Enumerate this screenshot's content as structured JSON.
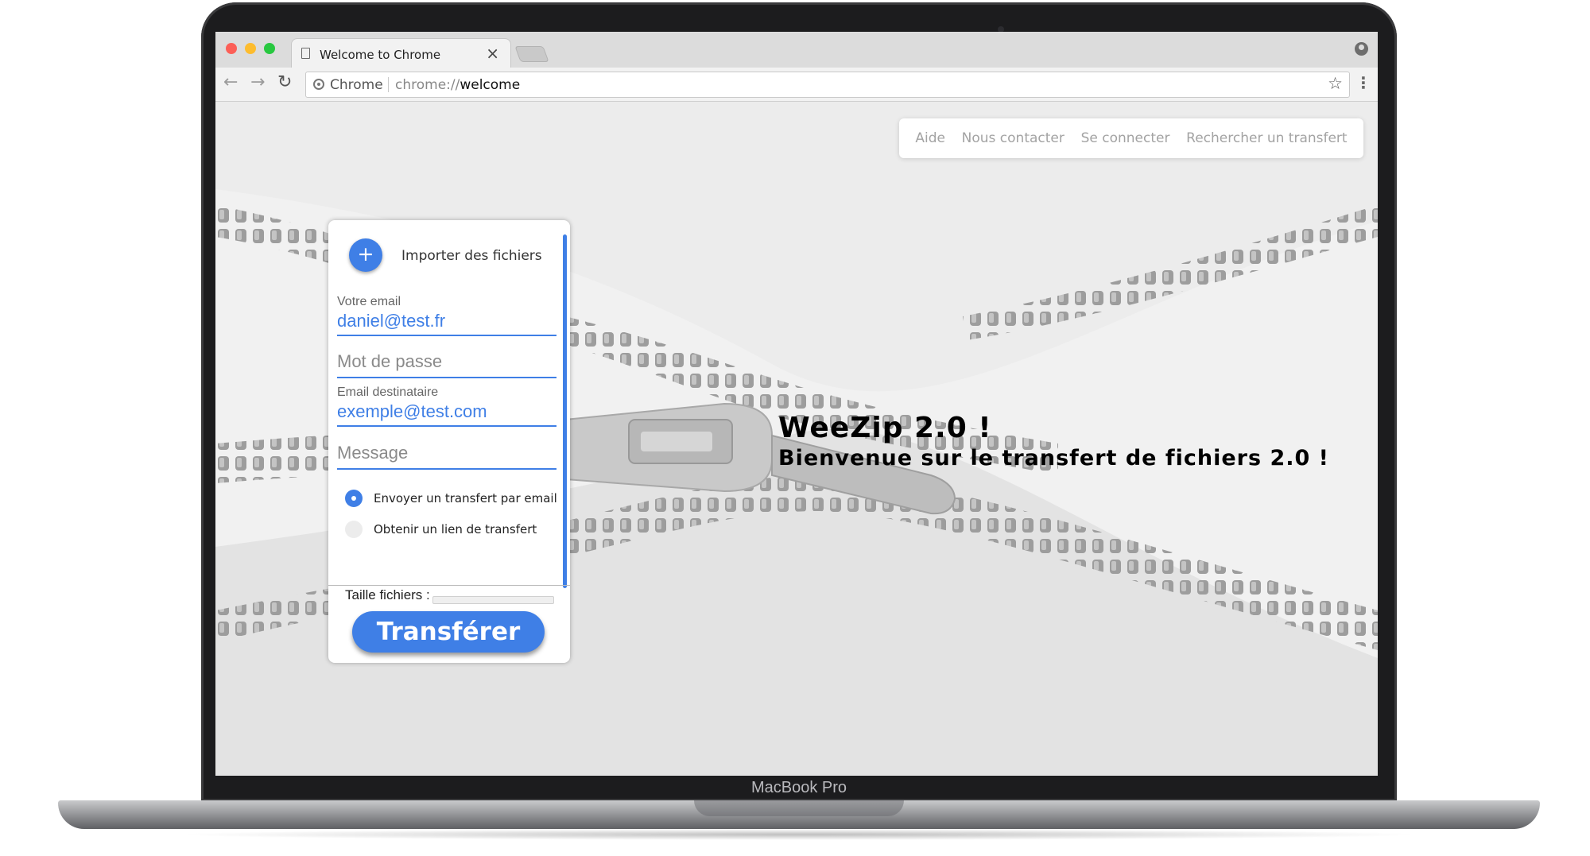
{
  "device": {
    "label": "MacBook Pro"
  },
  "browser": {
    "tab_title": "Welcome to Chrome",
    "tab_close": "×",
    "omnibox_chip": "Chrome",
    "url_scheme": "chrome://",
    "url_host": "welcome",
    "icons": [
      "back-arrow-icon",
      "forward-arrow-icon",
      "reload-icon",
      "star-icon",
      "menu-icon",
      "profile-icon"
    ]
  },
  "nav": {
    "items": [
      {
        "label": "Aide"
      },
      {
        "label": "Nous contacter"
      },
      {
        "label": "Se connecter"
      },
      {
        "label": "Rechercher un transfert"
      }
    ]
  },
  "hero": {
    "title": "WeeZip 2.0 !",
    "subtitle": "Bienvenue sur le transfert de fichiers 2.0 !"
  },
  "form": {
    "add_icon": "+",
    "add_label": "Importer des fichiers",
    "email": {
      "label": "Votre email",
      "value": "daniel@test.fr"
    },
    "password": {
      "placeholder": "Mot de passe"
    },
    "recipient": {
      "label": "Email destinataire",
      "value": "exemple@test.com"
    },
    "message": {
      "placeholder": "Message"
    },
    "options": [
      {
        "label": "Envoyer un transfert par email",
        "selected": true
      },
      {
        "label": "Obtenir un lien de transfert",
        "selected": false
      }
    ],
    "size_label": "Taille fichiers :",
    "size_progress": 0,
    "submit_label": "Transférer"
  },
  "colors": {
    "accent": "#3f7fe6",
    "nav_text": "#a3a3a3",
    "page_bg": "#ebebeb"
  }
}
